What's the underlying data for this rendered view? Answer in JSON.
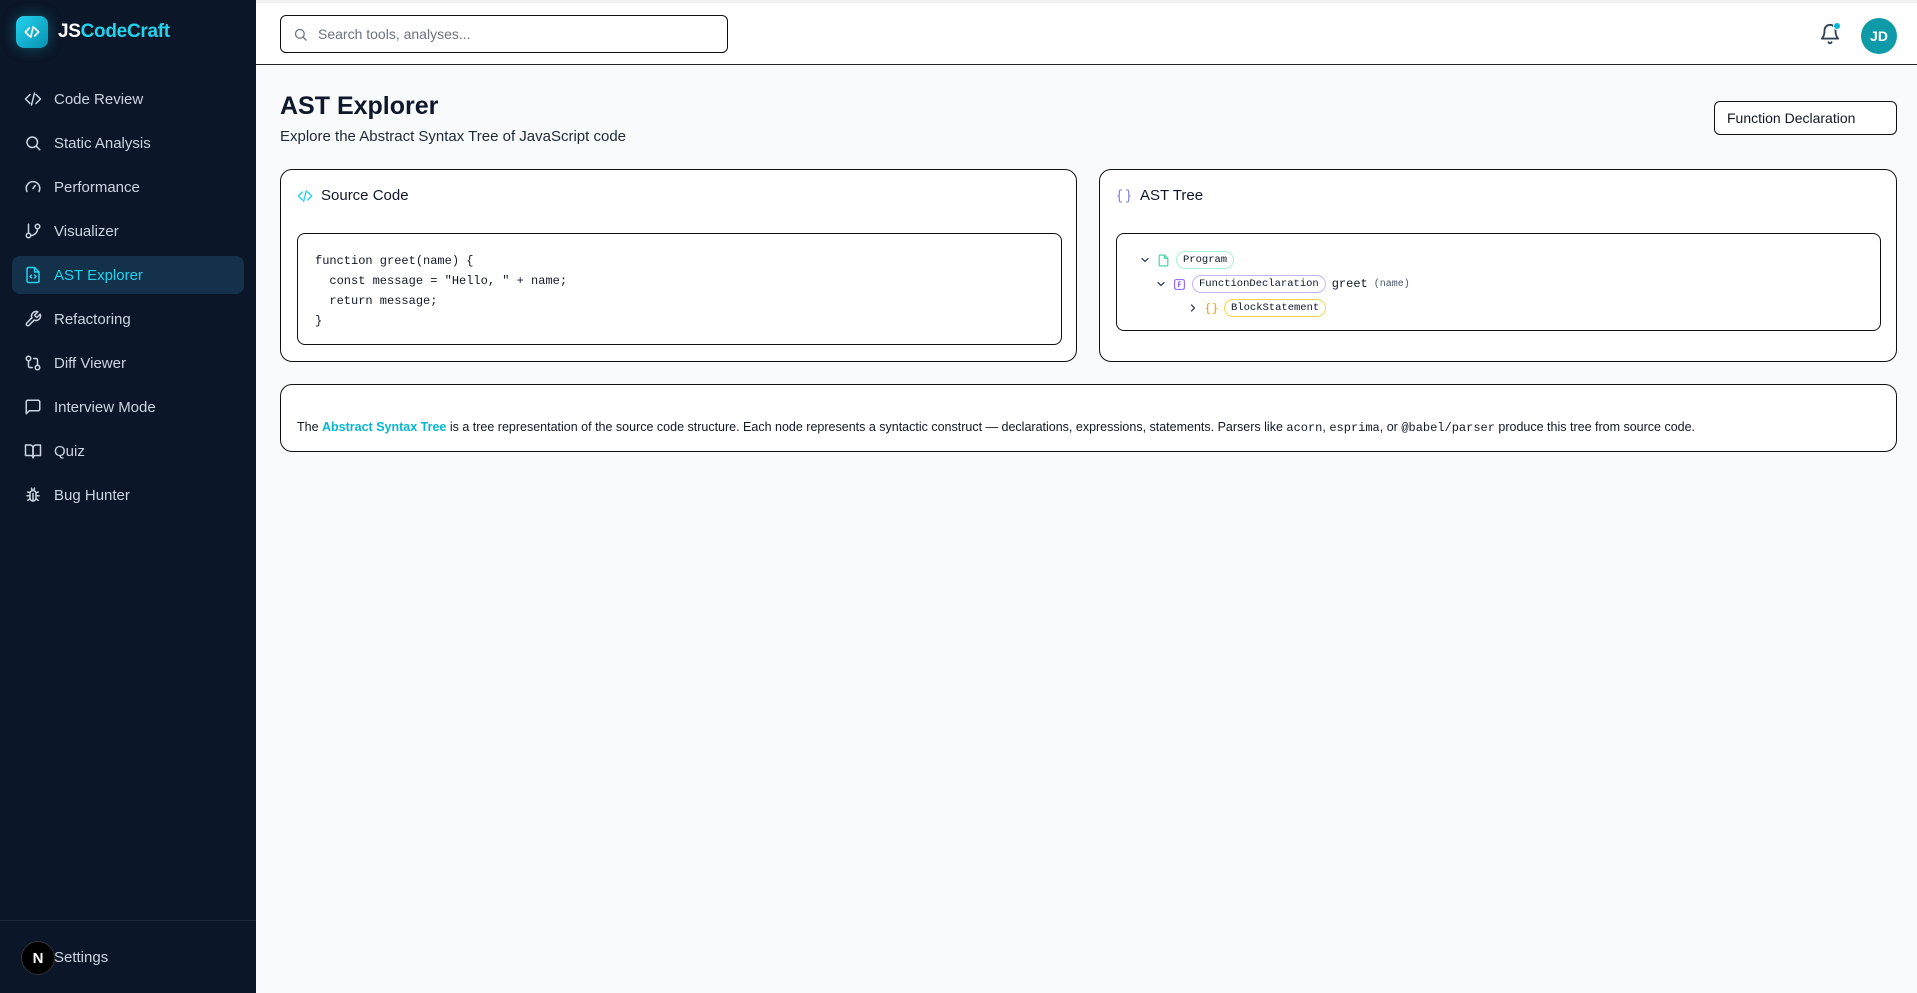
{
  "brand": {
    "prefix": "JS",
    "suffix": "CodeCraft"
  },
  "sidebar": {
    "items": [
      {
        "label": "Code Review",
        "icon": "code-icon"
      },
      {
        "label": "Static Analysis",
        "icon": "search-icon"
      },
      {
        "label": "Performance",
        "icon": "gauge-icon"
      },
      {
        "label": "Visualizer",
        "icon": "git-branch-icon"
      },
      {
        "label": "AST Explorer",
        "icon": "file-code-icon",
        "active": true
      },
      {
        "label": "Refactoring",
        "icon": "wrench-icon"
      },
      {
        "label": "Diff Viewer",
        "icon": "git-compare-icon"
      },
      {
        "label": "Interview Mode",
        "icon": "message-square-icon"
      },
      {
        "label": "Quiz",
        "icon": "book-open-icon"
      },
      {
        "label": "Bug Hunter",
        "icon": "bug-icon"
      }
    ],
    "footer": {
      "badge": "N",
      "label": "Settings"
    }
  },
  "header": {
    "search_placeholder": "Search tools, analyses...",
    "avatar_initials": "JD",
    "notification_dot_color": "#06b6d4"
  },
  "page": {
    "title": "AST Explorer",
    "subtitle": "Explore the Abstract Syntax Tree of JavaScript code",
    "example_select": "Function Declaration"
  },
  "source": {
    "title": "Source Code",
    "code": "function greet(name) {\n  const message = \"Hello, \" + name;\n  return message;\n}"
  },
  "tree": {
    "title": "AST Tree",
    "nodes": [
      {
        "type": "Program"
      },
      {
        "type": "FunctionDeclaration",
        "name": "greet",
        "params": "(name)"
      },
      {
        "type": "BlockStatement"
      }
    ]
  },
  "info": {
    "pre": "The ",
    "link": "Abstract Syntax Tree",
    "mid": " is a tree representation of the source code structure. Each node represents a syntactic construct — declarations, expressions, statements. Parsers like ",
    "code1": "acorn",
    "sep1": ", ",
    "code2": "esprima",
    "sep2": ", or ",
    "code3": "@babel/parser",
    "post": " produce this tree from source code."
  },
  "colors": {
    "accent": "#22d3ee",
    "sidebar_bg": "#0b1628",
    "active_bg": "#13314a"
  }
}
